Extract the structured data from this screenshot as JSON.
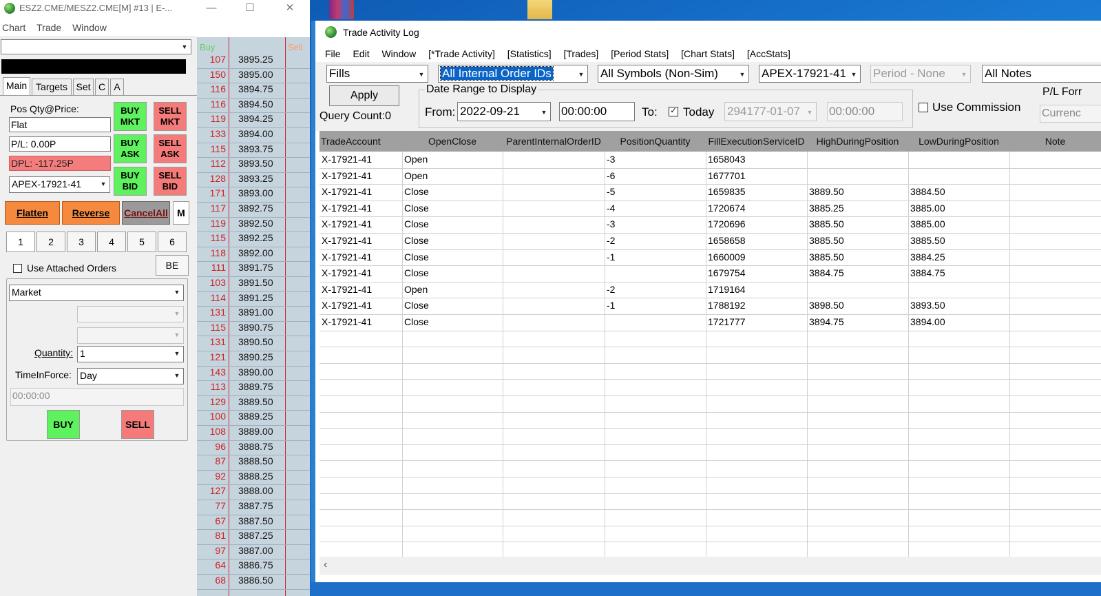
{
  "left_window": {
    "title": "ESZ2.CME/MESZ2.CME[M]  #13 | E-...",
    "menu": [
      "Chart",
      "Trade",
      "Window"
    ],
    "tabs": [
      "Main",
      "Targets",
      "Set",
      "C",
      "A"
    ],
    "pos_label": "Pos Qty@Price:",
    "pos_value": "Flat",
    "pl_value": "P/L: 0.00P",
    "dpl_value": "DPL: -117.25P",
    "account": "APEX-17921-41",
    "trade_buttons": {
      "buy_mkt": "BUY MKT",
      "sell_mkt": "SELL MKT",
      "buy_ask": "BUY ASK",
      "sell_ask": "SELL ASK",
      "buy_bid": "BUY BID",
      "sell_bid": "SELL BID"
    },
    "flatten": "Flatten",
    "reverse": "Reverse",
    "cancel_all": "CancelAll",
    "m_button": "M",
    "number_buttons": [
      "1",
      "2",
      "3",
      "4",
      "5",
      "6"
    ],
    "use_attached_label": "Use Attached Orders",
    "be_button": "BE",
    "order_type": "Market",
    "quantity_label": "Quantity:",
    "quantity_value": "1",
    "tif_label": "TimeInForce:",
    "tif_value": "Day",
    "time_value": "00:00:00",
    "buy_button": "BUY",
    "sell_button": "SELL"
  },
  "ladder": {
    "buy_header": "Buy",
    "sell_header": "Sell",
    "rows": [
      {
        "bid": "107",
        "price": "3895.25"
      },
      {
        "bid": "150",
        "price": "3895.00"
      },
      {
        "bid": "116",
        "price": "3894.75"
      },
      {
        "bid": "116",
        "price": "3894.50"
      },
      {
        "bid": "119",
        "price": "3894.25"
      },
      {
        "bid": "133",
        "price": "3894.00"
      },
      {
        "bid": "115",
        "price": "3893.75"
      },
      {
        "bid": "112",
        "price": "3893.50"
      },
      {
        "bid": "128",
        "price": "3893.25"
      },
      {
        "bid": "171",
        "price": "3893.00"
      },
      {
        "bid": "117",
        "price": "3892.75"
      },
      {
        "bid": "119",
        "price": "3892.50"
      },
      {
        "bid": "115",
        "price": "3892.25"
      },
      {
        "bid": "118",
        "price": "3892.00"
      },
      {
        "bid": "111",
        "price": "3891.75"
      },
      {
        "bid": "103",
        "price": "3891.50"
      },
      {
        "bid": "114",
        "price": "3891.25"
      },
      {
        "bid": "131",
        "price": "3891.00"
      },
      {
        "bid": "115",
        "price": "3890.75"
      },
      {
        "bid": "131",
        "price": "3890.50"
      },
      {
        "bid": "121",
        "price": "3890.25"
      },
      {
        "bid": "143",
        "price": "3890.00"
      },
      {
        "bid": "113",
        "price": "3889.75"
      },
      {
        "bid": "129",
        "price": "3889.50"
      },
      {
        "bid": "100",
        "price": "3889.25"
      },
      {
        "bid": "108",
        "price": "3889.00"
      },
      {
        "bid": "96",
        "price": "3888.75"
      },
      {
        "bid": "87",
        "price": "3888.50"
      },
      {
        "bid": "92",
        "price": "3888.25"
      },
      {
        "bid": "127",
        "price": "3888.00"
      },
      {
        "bid": "77",
        "price": "3887.75"
      },
      {
        "bid": "67",
        "price": "3887.50"
      },
      {
        "bid": "81",
        "price": "3887.25"
      },
      {
        "bid": "97",
        "price": "3887.00"
      },
      {
        "bid": "64",
        "price": "3886.75"
      },
      {
        "bid": "68",
        "price": "3886.50"
      }
    ]
  },
  "tal": {
    "title": "Trade Activity Log",
    "menu": [
      "File",
      "Edit",
      "Window",
      "[*Trade Activity]",
      "[Statistics]",
      "[Trades]",
      "[Period Stats]",
      "[Chart Stats]",
      "[AccStats]"
    ],
    "filters": {
      "type": "Fills",
      "order_ids": "All Internal Order IDs",
      "symbols": "All Symbols (Non-Sim)",
      "account": "APEX-17921-41",
      "period": "Period - None",
      "notes": "All Notes"
    },
    "apply": "Apply",
    "query_count": "Query Count:0",
    "date_range_label": "Date Range to Display",
    "from_label": "From:",
    "from_date": "2022-09-21",
    "from_time": "00:00:00",
    "to_label": "To:",
    "today_label": "Today",
    "to_date": "294177-01-07",
    "to_time": "00:00:00",
    "use_commission": "Use Commission",
    "pl_format_label": "P/L Forr",
    "pl_format_value": "Currenc",
    "columns": [
      "TradeAccount",
      "OpenClose",
      "ParentInternalOrderID",
      "PositionQuantity",
      "FillExecutionServiceID",
      "HighDuringPosition",
      "LowDuringPosition",
      "Note"
    ],
    "rows": [
      [
        "X-17921-41",
        "Open",
        "",
        "-3",
        "1658043",
        "",
        "",
        ""
      ],
      [
        "X-17921-41",
        "Open",
        "",
        "-6",
        "1677701",
        "",
        "",
        ""
      ],
      [
        "X-17921-41",
        "Close",
        "",
        "-5",
        "1659835",
        "3889.50",
        "3884.50",
        ""
      ],
      [
        "X-17921-41",
        "Close",
        "",
        "-4",
        "1720674",
        "3885.25",
        "3885.00",
        ""
      ],
      [
        "X-17921-41",
        "Close",
        "",
        "-3",
        "1720696",
        "3885.50",
        "3885.00",
        ""
      ],
      [
        "X-17921-41",
        "Close",
        "",
        "-2",
        "1658658",
        "3885.50",
        "3885.50",
        ""
      ],
      [
        "X-17921-41",
        "Close",
        "",
        "-1",
        "1660009",
        "3885.50",
        "3884.25",
        ""
      ],
      [
        "X-17921-41",
        "Close",
        "",
        "",
        "1679754",
        "3884.75",
        "3884.75",
        ""
      ],
      [
        "X-17921-41",
        "Open",
        "",
        "-2",
        "1719164",
        "",
        "",
        ""
      ],
      [
        "X-17921-41",
        "Close",
        "",
        "-1",
        "1788192",
        "3898.50",
        "3893.50",
        ""
      ],
      [
        "X-17921-41",
        "Close",
        "",
        "",
        "1721777",
        "3894.75",
        "3894.00",
        ""
      ]
    ]
  },
  "colors": {
    "buy_green": "#5ef25e",
    "sell_red": "#f57b7b",
    "flatten_orange": "#f58a3e",
    "ladder_bg": "#c6d4de",
    "selection_blue": "#0a64c8"
  }
}
